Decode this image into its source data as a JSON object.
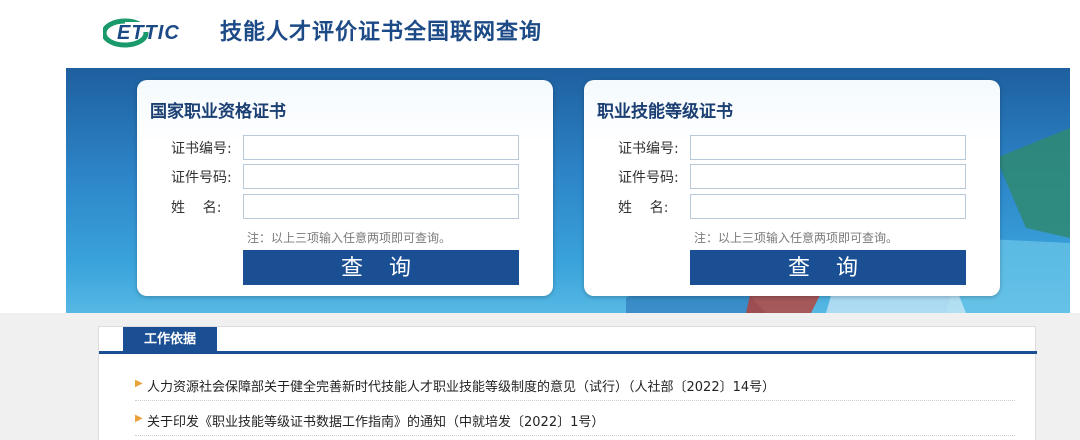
{
  "header": {
    "logo_text": "ETTIC",
    "title": "技能人才评价证书全国联网查询"
  },
  "cards": [
    {
      "title": "国家职业资格证书",
      "fields": [
        {
          "label": "证书编号:",
          "value": ""
        },
        {
          "label": "证件号码:",
          "value": ""
        },
        {
          "label": "姓    名:",
          "value": ""
        }
      ],
      "note": "注：以上三项输入任意两项即可查询。",
      "button": "查 询"
    },
    {
      "title": "职业技能等级证书",
      "fields": [
        {
          "label": "证书编号:",
          "value": ""
        },
        {
          "label": "证件号码:",
          "value": ""
        },
        {
          "label": "姓    名:",
          "value": ""
        }
      ],
      "note": "注：以上三项输入任意两项即可查询。",
      "button": "查 询"
    }
  ],
  "basis": {
    "tab": "工作依据",
    "items": [
      "人力资源社会保障部关于健全完善新时代技能人才职业技能等级制度的意见（试行）（人社部〔2022〕14号）",
      "关于印发《职业技能等级证书数据工作指南》的通知（中就培发〔2022〕1号）"
    ]
  },
  "colors": {
    "brand_blue": "#1b4f94",
    "title_blue": "#1c4a86",
    "logo_green": "#1a9a6a"
  }
}
